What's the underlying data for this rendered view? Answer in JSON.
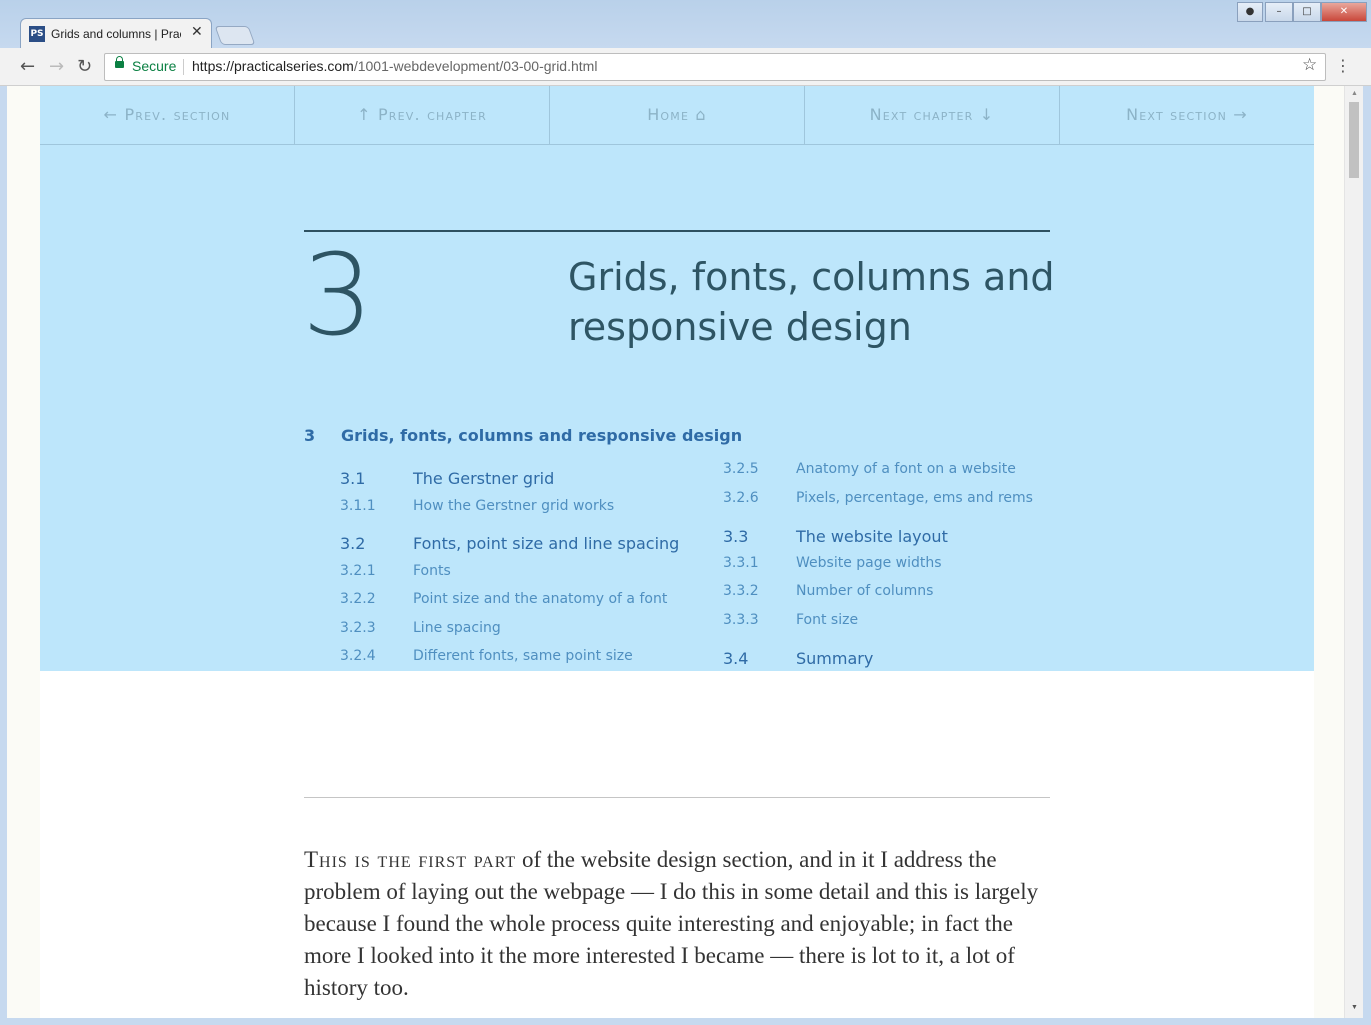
{
  "browser": {
    "tab_title": "Grids and columns | Practical Series",
    "favicon_text": "PS",
    "close_glyph": "✕",
    "secure_label": "Secure",
    "url_host": "https://practicalseries.com",
    "url_path": "/1001-webdevelopment/03-00-grid.html",
    "icons": [
      "back-icon",
      "forward-icon",
      "reload-icon",
      "lock-icon",
      "star-icon",
      "menu-icon"
    ]
  },
  "navbar": {
    "prev_section": "← Prev. section",
    "prev_chapter": "↑ Prev. chapter",
    "home": "Home ⌂",
    "next_chapter": "Next chapter ↓",
    "next_section": "Next section →"
  },
  "chapter": {
    "number": "3",
    "title": "Grids, fonts, columns and responsive design"
  },
  "toc": {
    "main": {
      "num": "3",
      "label": "Grids, fonts, columns and responsive design"
    },
    "left": [
      {
        "num": "3.1",
        "label": "The Gerstner grid",
        "level": "section"
      },
      {
        "num": "3.1.1",
        "label": "How the Gerstner grid works",
        "level": "sub"
      },
      {
        "num": "3.2",
        "label": "Fonts, point size and line spacing",
        "level": "section"
      },
      {
        "num": "3.2.1",
        "label": "Fonts",
        "level": "sub"
      },
      {
        "num": "3.2.2",
        "label": "Point size and the anatomy of a font",
        "level": "sub"
      },
      {
        "num": "3.2.3",
        "label": "Line spacing",
        "level": "sub"
      },
      {
        "num": "3.2.4",
        "label": "Different fonts, same point size",
        "level": "sub"
      }
    ],
    "right": [
      {
        "num": "3.2.5",
        "label": "Anatomy of a font on a website",
        "level": "sub"
      },
      {
        "num": "3.2.6",
        "label": "Pixels, percentage, ems and rems",
        "level": "sub"
      },
      {
        "num": "3.3",
        "label": "The website layout",
        "level": "section"
      },
      {
        "num": "3.3.1",
        "label": "Website page widths",
        "level": "sub"
      },
      {
        "num": "3.3.2",
        "label": "Number of columns",
        "level": "sub"
      },
      {
        "num": "3.3.3",
        "label": "Font size",
        "level": "sub"
      },
      {
        "num": "3.4",
        "label": "Summary",
        "level": "section"
      }
    ]
  },
  "body": {
    "lead": "This is the first part",
    "text": " of the website design section, and in it I address the problem of laying out the webpage — I do this in some detail and this is largely because I found the whole process quite interesting and enjoyable; in fact the more I looked into it the more interested I became — there is lot to it, a lot of history too."
  },
  "colors": {
    "hero_bg": "#bde6fb",
    "heading": "#2e5564",
    "toc_link": "#2f6ba6",
    "nav_text": "#8cb3c7"
  }
}
